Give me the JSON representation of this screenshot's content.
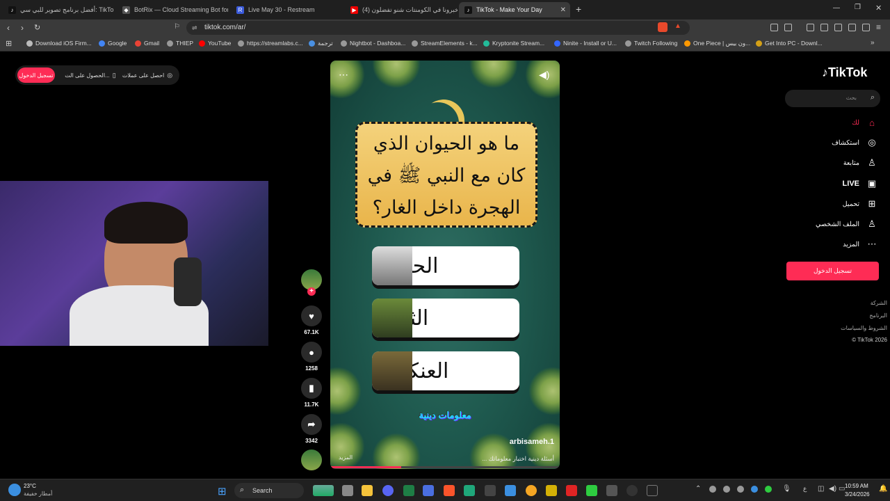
{
  "browser": {
    "tabs": [
      {
        "label": "أفضل برنامج تصوير للبي سي: TikTok",
        "active": false
      },
      {
        "label": "BotRix — Cloud Streaming Bot for Tw",
        "active": false
      },
      {
        "label": "Live May 30 - Restream",
        "active": false
      },
      {
        "label": "(4) خبرونا في الكومنتات شنو تفضلون",
        "active": false
      },
      {
        "label": "TikTok - Make Your Day",
        "active": true
      }
    ],
    "new_tab": "+",
    "url": "tiktok.com/ar/",
    "bookmarks": [
      "Download iOS Firm...",
      "Google",
      "Gmail",
      "THIEP",
      "YouTube",
      "https://streamlabs.c...",
      "ترجمة",
      "Nightbot - Dashboa...",
      "StreamElements - k...",
      "Kryptonite Stream...",
      "Ninite - Install or U...",
      "Twitch Following",
      "One Piece | ون بيس...",
      "Get Into PC - Downl..."
    ]
  },
  "page": {
    "top_pills": {
      "login": "تسجيل الدخول",
      "get_app": "الحصول على الت...",
      "get_coins": "احصل على عملات"
    },
    "video": {
      "question": "ما هو الحيوان الذي كان مع النبي ﷺ في الهجرة داخل الغار؟",
      "answers": [
        "الحمامة",
        "الثعبان",
        "العنكبوت"
      ],
      "tag": "معلومات دينية",
      "author": "arbisameh.1",
      "caption": "أسئلة دينية اختبار معلوماتك ...",
      "more": "المزيد"
    },
    "actions": {
      "likes": "67.1K",
      "comments": "1258",
      "saves": "11.7K",
      "shares": "3342"
    },
    "sidebar": {
      "logo": "TikTok",
      "search_placeholder": "بحث",
      "nav": [
        "لك",
        "استكشاف",
        "متابعة",
        "LIVE",
        "تحميل",
        "الملف الشخصي",
        "المزيد"
      ],
      "login_button": "تسجيل الدخول",
      "footer": [
        "الشركة",
        "البرنامج",
        "الشروط والسياسات",
        "© TikTok 2026"
      ]
    }
  },
  "taskbar": {
    "weather_temp": "23°C",
    "weather_desc": "أمطار خفيفة",
    "search": "Search",
    "time": "10:59 AM",
    "date": "3/24/2026"
  },
  "colors": {
    "accent": "#fe2c55",
    "chrome_dark": "#1f1f1f",
    "chrome": "#3a3a3a"
  }
}
